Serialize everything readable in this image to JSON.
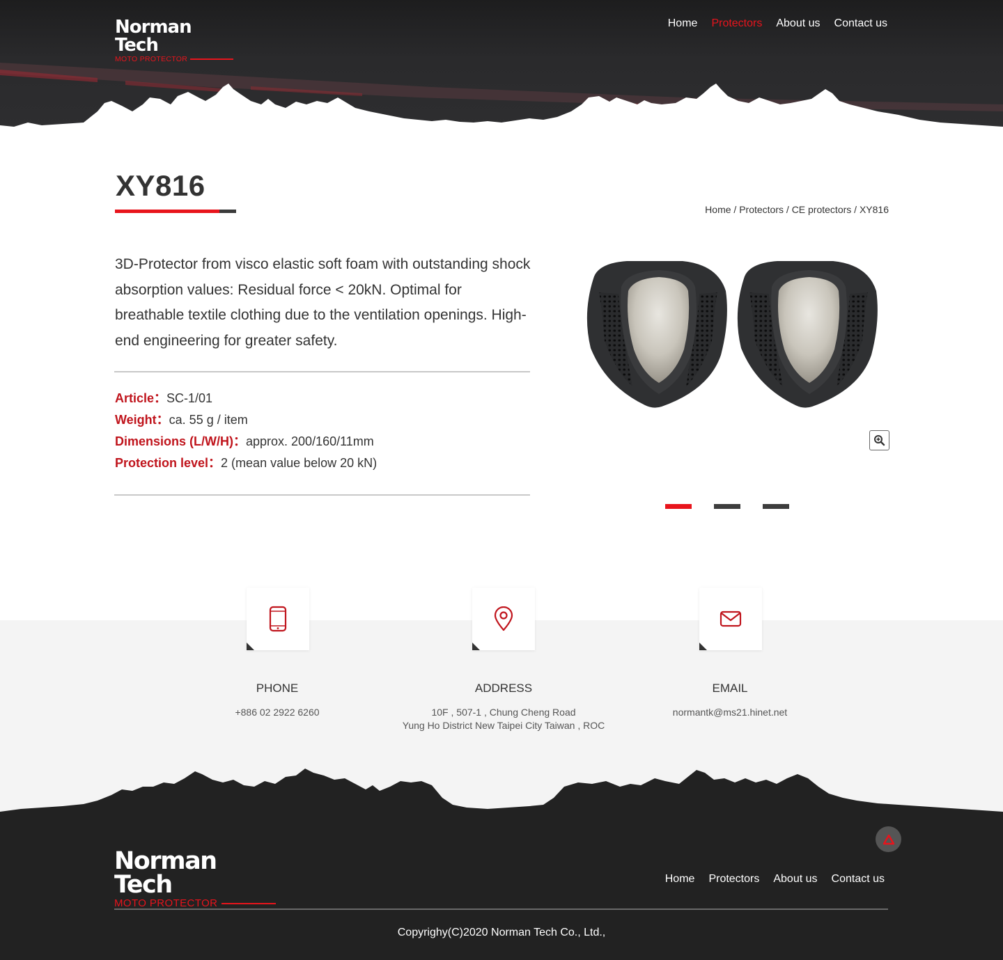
{
  "header": {
    "brand": "Norman Tech",
    "brand_sub": "MOTO PROTECTOR",
    "nav": [
      "Home",
      "Protectors",
      "About us",
      "Contact us"
    ],
    "active_nav": "Protectors"
  },
  "page": {
    "title": "XY816",
    "breadcrumb": [
      "Home",
      "Protectors",
      "CE protectors",
      "XY816"
    ],
    "breadcrumb_sep": " / "
  },
  "product": {
    "description": "3D-Protector from visco elastic soft foam with outstanding shock absorption values: Residual force < 20kN. Optimal for breathable textile clothing due to the ventilation openings. High-end engineering for greater safety.",
    "specs": [
      {
        "label": "Article",
        "sep": "：",
        "value": "SC-1/01"
      },
      {
        "label": "Weight",
        "sep": "：",
        "value": "ca. 55 g / item"
      },
      {
        "label": "Dimensions (L/W/H)",
        "sep": "：",
        "value": "approx. 200/160/11mm"
      },
      {
        "label": "Protection level",
        "sep": "：",
        "value": "2 (mean value below 20 kN)"
      }
    ],
    "zoom_icon": "zoom-in-icon",
    "slides_total": 3,
    "active_slide": 1
  },
  "contact": {
    "phone": {
      "label": "PHONE",
      "value": "+886 02 2922 6260",
      "icon": "phone-icon"
    },
    "address": {
      "label": "ADDRESS",
      "line1": "10F , 507-1 , Chung Cheng Road",
      "line2": "Yung Ho District New Taipei City Taiwan , ROC",
      "icon": "location-pin-icon"
    },
    "email": {
      "label": "EMAIL",
      "value": "normantk@ms21.hinet.net",
      "icon": "mail-icon"
    }
  },
  "footer": {
    "brand": "Norman Tech",
    "brand_sub": "MOTO PROTECTOR",
    "nav": [
      "Home",
      "Protectors",
      "About us",
      "Contact us"
    ],
    "copyright": "Copyrighy(C)2020  Norman Tech Co., Ltd.,"
  },
  "colors": {
    "accent": "#e8141c",
    "label_red": "#c0141c",
    "dark": "#222222",
    "band": "#f4f4f4"
  }
}
